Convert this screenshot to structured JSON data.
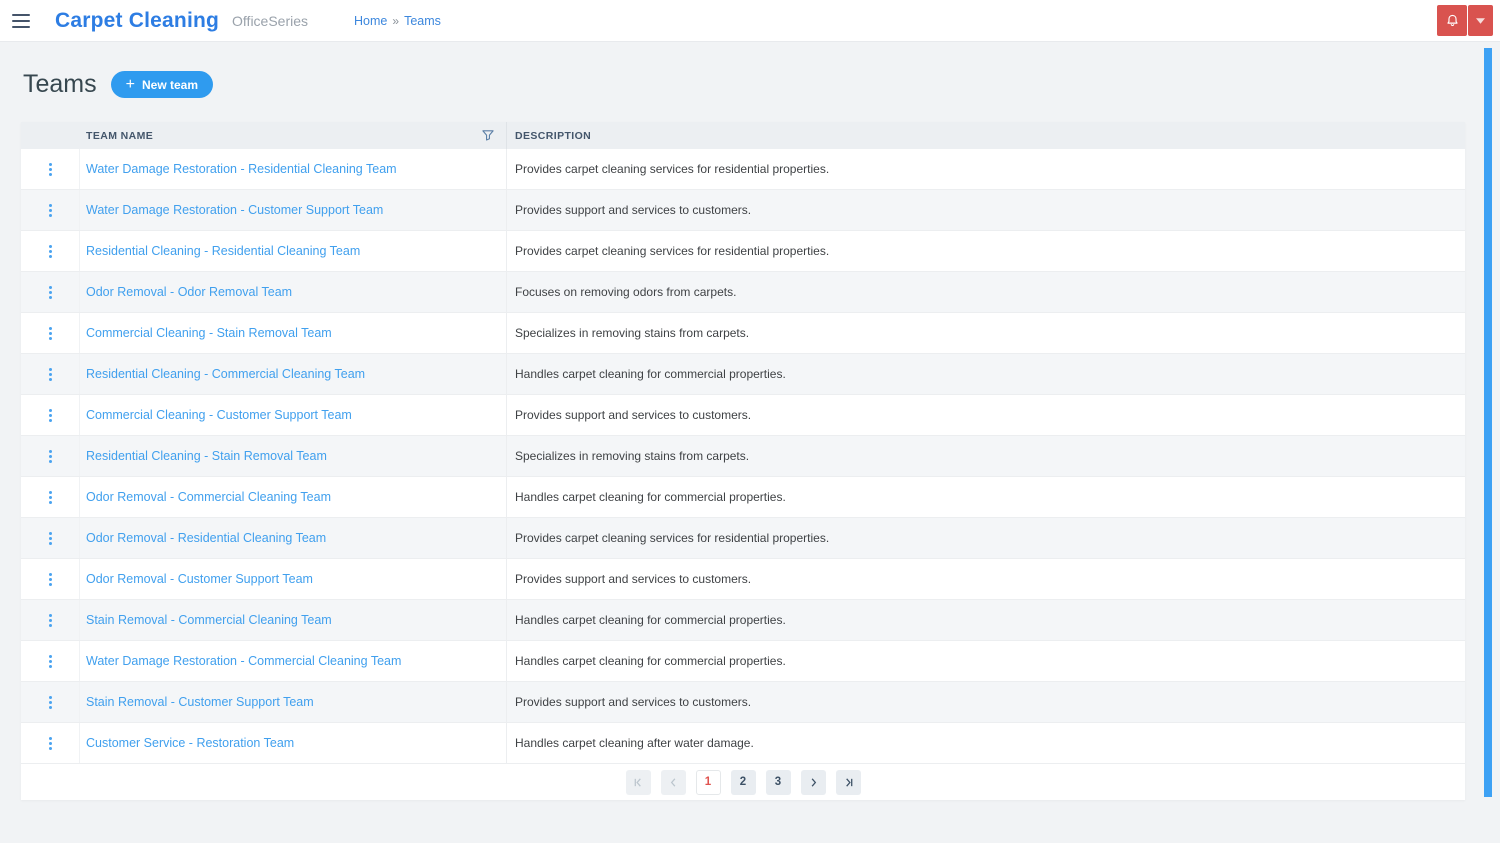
{
  "header": {
    "brand": "Carpet Cleaning",
    "suite": "OfficeSeries",
    "breadcrumb": {
      "home": "Home",
      "separator": "»",
      "current": "Teams"
    }
  },
  "page": {
    "title": "Teams",
    "new_team_plus": "+",
    "new_team_button": "New team"
  },
  "table": {
    "columns": {
      "team_name": "TEAM NAME",
      "description": "DESCRIPTION"
    },
    "rows": [
      {
        "name": "Water Damage Restoration - Residential Cleaning Team",
        "description": "Provides carpet cleaning services for residential properties."
      },
      {
        "name": "Water Damage Restoration - Customer Support Team",
        "description": "Provides support and services to customers."
      },
      {
        "name": "Residential Cleaning - Residential Cleaning Team",
        "description": "Provides carpet cleaning services for residential properties."
      },
      {
        "name": "Odor Removal - Odor Removal Team",
        "description": "Focuses on removing odors from carpets."
      },
      {
        "name": "Commercial Cleaning - Stain Removal Team",
        "description": "Specializes in removing stains from carpets."
      },
      {
        "name": "Residential Cleaning - Commercial Cleaning Team",
        "description": "Handles carpet cleaning for commercial properties."
      },
      {
        "name": "Commercial Cleaning - Customer Support Team",
        "description": "Provides support and services to customers."
      },
      {
        "name": "Residential Cleaning - Stain Removal Team",
        "description": "Specializes in removing stains from carpets."
      },
      {
        "name": "Odor Removal - Commercial Cleaning Team",
        "description": "Handles carpet cleaning for commercial properties."
      },
      {
        "name": "Odor Removal - Residential Cleaning Team",
        "description": "Provides carpet cleaning services for residential properties."
      },
      {
        "name": "Odor Removal - Customer Support Team",
        "description": "Provides support and services to customers."
      },
      {
        "name": "Stain Removal - Commercial Cleaning Team",
        "description": "Handles carpet cleaning for commercial properties."
      },
      {
        "name": "Water Damage Restoration - Commercial Cleaning Team",
        "description": "Handles carpet cleaning for commercial properties."
      },
      {
        "name": "Stain Removal - Customer Support Team",
        "description": "Provides support and services to customers."
      },
      {
        "name": "Customer Service - Restoration Team",
        "description": "Handles carpet cleaning after water damage."
      }
    ]
  },
  "pagination": {
    "pages": [
      "1",
      "2",
      "3"
    ],
    "active_page": "1",
    "disabled_nav": [
      "first",
      "prev"
    ]
  },
  "icons": {
    "hamburger": "menu-icon",
    "bell": "bell-icon",
    "caret": "caret-down-icon",
    "filter": "filter-funnel-icon",
    "kebab": "kebab-menu-icon",
    "plus": "plus-icon",
    "first": "first-page-icon",
    "prev": "prev-page-icon",
    "next": "next-page-icon",
    "last": "last-page-icon"
  },
  "colors": {
    "brand_blue": "#2d7de3",
    "link_blue": "#41a0ee",
    "button_blue": "#2f9bef",
    "alert_red": "#d9534f",
    "active_page_red": "#e0534f",
    "scrollbar_blue": "#3da1f4",
    "page_background": "#f1f3f5",
    "table_header_bg": "#eceff2"
  }
}
